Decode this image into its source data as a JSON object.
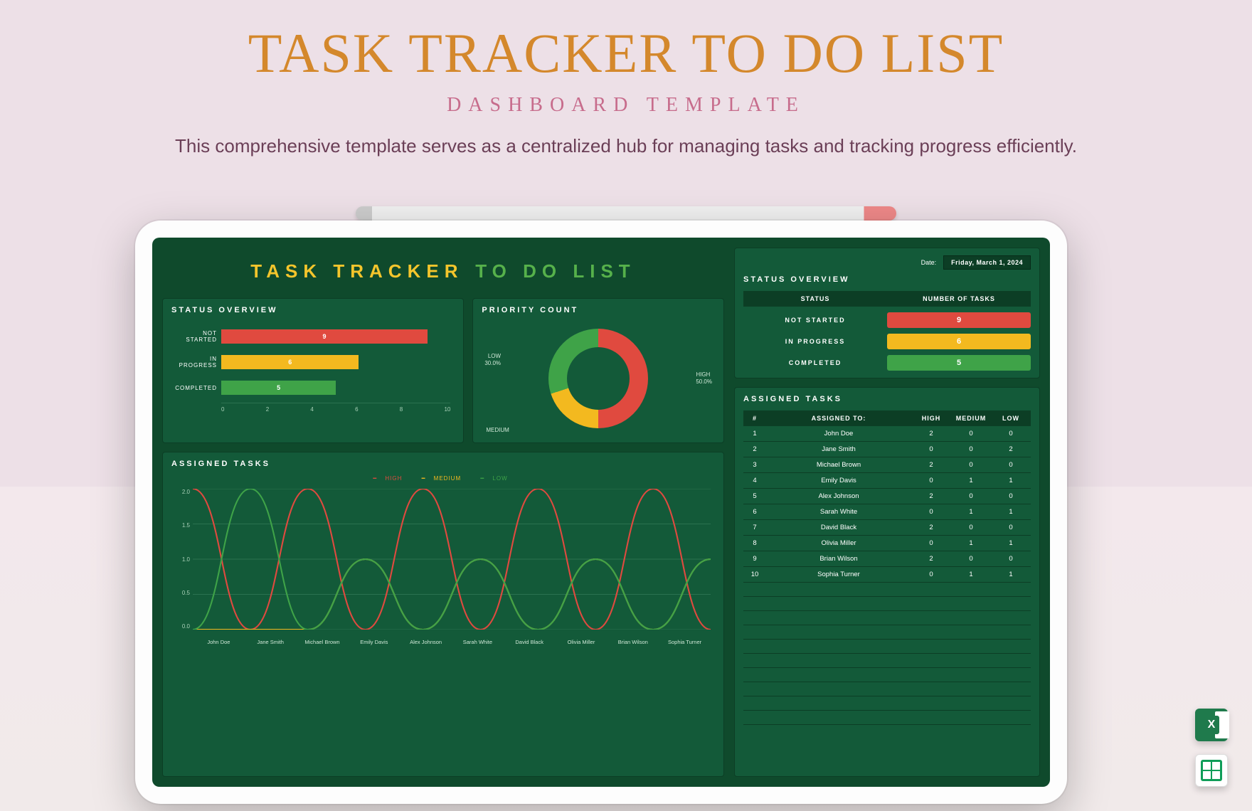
{
  "hero": {
    "title": "TASK TRACKER TO DO LIST",
    "subtitle": "DASHBOARD TEMPLATE",
    "description": "This comprehensive template serves as a centralized hub for managing tasks and tracking progress efficiently."
  },
  "dashboard": {
    "title_a": "TASK TRACKER",
    "title_b": "TO DO LIST",
    "date_label": "Date:",
    "date_value": "Friday, March 1, 2024",
    "panels": {
      "status_overview": "STATUS OVERVIEW",
      "priority_count": "PRIORITY COUNT",
      "assigned_tasks": "ASSIGNED TASKS"
    },
    "legend": {
      "high": "HIGH",
      "medium": "MEDIUM",
      "low": "LOW"
    },
    "table_headers": {
      "status": "STATUS",
      "num_tasks": "NUMBER OF TASKS",
      "num": "#",
      "assigned_to": "ASSIGNED TO:",
      "high": "HIGH",
      "medium": "MEDIUM",
      "low": "LOW"
    },
    "status_labels": {
      "not_started": "NOT STARTED",
      "in_progress": "IN PROGRESS",
      "completed": "COMPLETED"
    },
    "status_values": {
      "not_started": "9",
      "in_progress": "6",
      "completed": "5"
    },
    "assignees": [
      {
        "n": "1",
        "name": "John Doe",
        "high": "2",
        "medium": "0",
        "low": "0"
      },
      {
        "n": "2",
        "name": "Jane Smith",
        "high": "0",
        "medium": "0",
        "low": "2"
      },
      {
        "n": "3",
        "name": "Michael Brown",
        "high": "2",
        "medium": "0",
        "low": "0"
      },
      {
        "n": "4",
        "name": "Emily Davis",
        "high": "0",
        "medium": "1",
        "low": "1"
      },
      {
        "n": "5",
        "name": "Alex Johnson",
        "high": "2",
        "medium": "0",
        "low": "0"
      },
      {
        "n": "6",
        "name": "Sarah White",
        "high": "0",
        "medium": "1",
        "low": "1"
      },
      {
        "n": "7",
        "name": "David Black",
        "high": "2",
        "medium": "0",
        "low": "0"
      },
      {
        "n": "8",
        "name": "Olivia Miller",
        "high": "0",
        "medium": "1",
        "low": "1"
      },
      {
        "n": "9",
        "name": "Brian Wilson",
        "high": "2",
        "medium": "0",
        "low": "0"
      },
      {
        "n": "10",
        "name": "Sophia Turner",
        "high": "0",
        "medium": "1",
        "low": "1"
      }
    ],
    "donut_labels": {
      "high": "HIGH",
      "high_pct": "50.0%",
      "medium": "MEDIUM",
      "medium_pct": "",
      "low": "LOW",
      "low_pct": "30.0%"
    },
    "axis_x": [
      "0",
      "2",
      "4",
      "6",
      "8",
      "10"
    ],
    "line_y": [
      "2.0",
      "1.5",
      "1.0",
      "0.5",
      "0.0"
    ]
  },
  "colors": {
    "red": "#E04A3F",
    "amber": "#F3B91F",
    "green": "#3FA348"
  },
  "chart_data": [
    {
      "type": "bar",
      "title": "STATUS OVERVIEW",
      "orientation": "horizontal",
      "categories": [
        "NOT STARTED",
        "IN PROGRESS",
        "COMPLETED"
      ],
      "values": [
        9,
        6,
        5
      ],
      "colors": [
        "#E04A3F",
        "#F3B91F",
        "#3FA348"
      ],
      "xlim": [
        0,
        10
      ],
      "xlabel": "",
      "ylabel": ""
    },
    {
      "type": "pie",
      "title": "PRIORITY COUNT",
      "donut": true,
      "categories": [
        "HIGH",
        "MEDIUM",
        "LOW"
      ],
      "values": [
        50.0,
        20.0,
        30.0
      ],
      "colors": [
        "#E04A3F",
        "#F3B91F",
        "#3FA348"
      ]
    },
    {
      "type": "line",
      "title": "ASSIGNED TASKS",
      "x": [
        "John Doe",
        "Jane Smith",
        "Michael Brown",
        "Emily Davis",
        "Alex Johnson",
        "Sarah White",
        "David Black",
        "Olivia Miller",
        "Brian Wilson",
        "Sophia Turner"
      ],
      "series": [
        {
          "name": "HIGH",
          "color": "#E04A3F",
          "values": [
            2,
            0,
            2,
            0,
            2,
            0,
            2,
            0,
            2,
            0
          ]
        },
        {
          "name": "MEDIUM",
          "color": "#F3B91F",
          "values": [
            0,
            0,
            0,
            1,
            0,
            1,
            0,
            1,
            0,
            1
          ]
        },
        {
          "name": "LOW",
          "color": "#3FA348",
          "values": [
            0,
            2,
            0,
            1,
            0,
            1,
            0,
            1,
            0,
            1
          ]
        }
      ],
      "ylim": [
        0,
        2
      ],
      "xlabel": "",
      "ylabel": ""
    },
    {
      "type": "table",
      "title": "STATUS OVERVIEW",
      "columns": [
        "STATUS",
        "NUMBER OF TASKS"
      ],
      "rows": [
        [
          "NOT STARTED",
          9
        ],
        [
          "IN PROGRESS",
          6
        ],
        [
          "COMPLETED",
          5
        ]
      ]
    },
    {
      "type": "table",
      "title": "ASSIGNED TASKS",
      "columns": [
        "#",
        "ASSIGNED TO:",
        "HIGH",
        "MEDIUM",
        "LOW"
      ],
      "rows": [
        [
          1,
          "John Doe",
          2,
          0,
          0
        ],
        [
          2,
          "Jane Smith",
          0,
          0,
          2
        ],
        [
          3,
          "Michael Brown",
          2,
          0,
          0
        ],
        [
          4,
          "Emily Davis",
          0,
          1,
          1
        ],
        [
          5,
          "Alex Johnson",
          2,
          0,
          0
        ],
        [
          6,
          "Sarah White",
          0,
          1,
          1
        ],
        [
          7,
          "David Black",
          2,
          0,
          0
        ],
        [
          8,
          "Olivia Miller",
          0,
          1,
          1
        ],
        [
          9,
          "Brian Wilson",
          2,
          0,
          0
        ],
        [
          10,
          "Sophia Turner",
          0,
          1,
          1
        ]
      ]
    }
  ]
}
